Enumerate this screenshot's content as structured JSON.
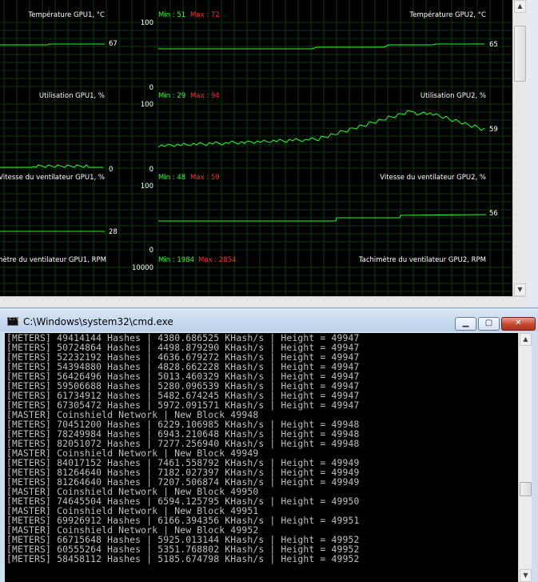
{
  "monitor": {
    "rows": [
      {
        "left_title": "Température GPU1, °C",
        "left_value": "67",
        "right_min_label": "Min : 51",
        "right_max_label": "Max : 72",
        "right_title": "Température GPU2, °C",
        "scale_top": "100",
        "scale_bottom": "0",
        "right_value": "65"
      },
      {
        "left_title": "Utilisation GPU1, %",
        "left_value": "0",
        "right_min_label": "Min : 29",
        "right_max_label": "Max : 94",
        "right_title": "Utilisation GPU2, %",
        "scale_top": "100",
        "scale_bottom": "0",
        "right_value": "59"
      },
      {
        "left_title": "Vitesse du ventilateur GPU1, %",
        "left_value": "28",
        "right_min_label": "Min : 48",
        "right_max_label": "Max : 59",
        "right_title": "Vitesse du ventilateur GPU2, %",
        "scale_top": "100",
        "scale_bottom": "0",
        "right_value": "56"
      },
      {
        "left_title": "hètre du ventilateur GPU1, RPM",
        "left_value": "",
        "right_min_label": "Min : 1984",
        "right_max_label": "Max : 2854",
        "right_title": "Tachimètre du ventilateur GPU2, RPM",
        "scale_top": "10000",
        "scale_bottom": "",
        "right_value": ""
      }
    ],
    "colors": {
      "grid": "#0b4a0b",
      "line": "#22ff22",
      "min": "#33ff33",
      "max": "#ff2a2a",
      "background": "#000000"
    }
  },
  "cmd": {
    "title": "C:\\Windows\\system32\\cmd.exe",
    "icon": "console-icon",
    "lines": [
      "[METERS] 49414144 Hashes | 4380.686525 KHash/s | Height = 49947",
      "[METERS] 50724864 Hashes | 4498.879290 KHash/s | Height = 49947",
      "[METERS] 52232192 Hashes | 4636.679272 KHash/s | Height = 49947",
      "[METERS] 54394880 Hashes | 4828.662228 KHash/s | Height = 49947",
      "[METERS] 56426496 Hashes | 5013.460329 KHash/s | Height = 49947",
      "[METERS] 59506688 Hashes | 5280.096539 KHash/s | Height = 49947",
      "[METERS] 61734912 Hashes | 5482.674245 KHash/s | Height = 49947",
      "[METERS] 67305472 Hashes | 5972.091571 KHash/s | Height = 49947",
      "[MASTER] Coinshield Network | New Block 49948",
      "[METERS] 70451200 Hashes | 6229.106985 KHash/s | Height = 49948",
      "[METERS] 78249984 Hashes | 6943.210648 KHash/s | Height = 49948",
      "[METERS] 82051072 Hashes | 7277.256940 KHash/s | Height = 49948",
      "[MASTER] Coinshield Network | New Block 49949",
      "[METERS] 84017152 Hashes | 7461.558792 KHash/s | Height = 49949",
      "[METERS] 81264640 Hashes | 7182.027397 KHash/s | Height = 49949",
      "[METERS] 81264640 Hashes | 7207.506874 KHash/s | Height = 49949",
      "[MASTER] Coinshield Network | New Block 49950",
      "[METERS] 74645504 Hashes | 6594.125795 KHash/s | Height = 49950",
      "[MASTER] Coinshield Network | New Block 49951",
      "[METERS] 69926912 Hashes | 6166.394356 KHash/s | Height = 49951",
      "[MASTER] Coinshield Network | New Block 49952",
      "[METERS] 66715648 Hashes | 5925.013144 KHash/s | Height = 49952",
      "[METERS] 60555264 Hashes | 5351.768802 KHash/s | Height = 49952",
      "[METERS] 58458112 Hashes | 5185.674798 KHash/s | Height = 49952"
    ]
  }
}
